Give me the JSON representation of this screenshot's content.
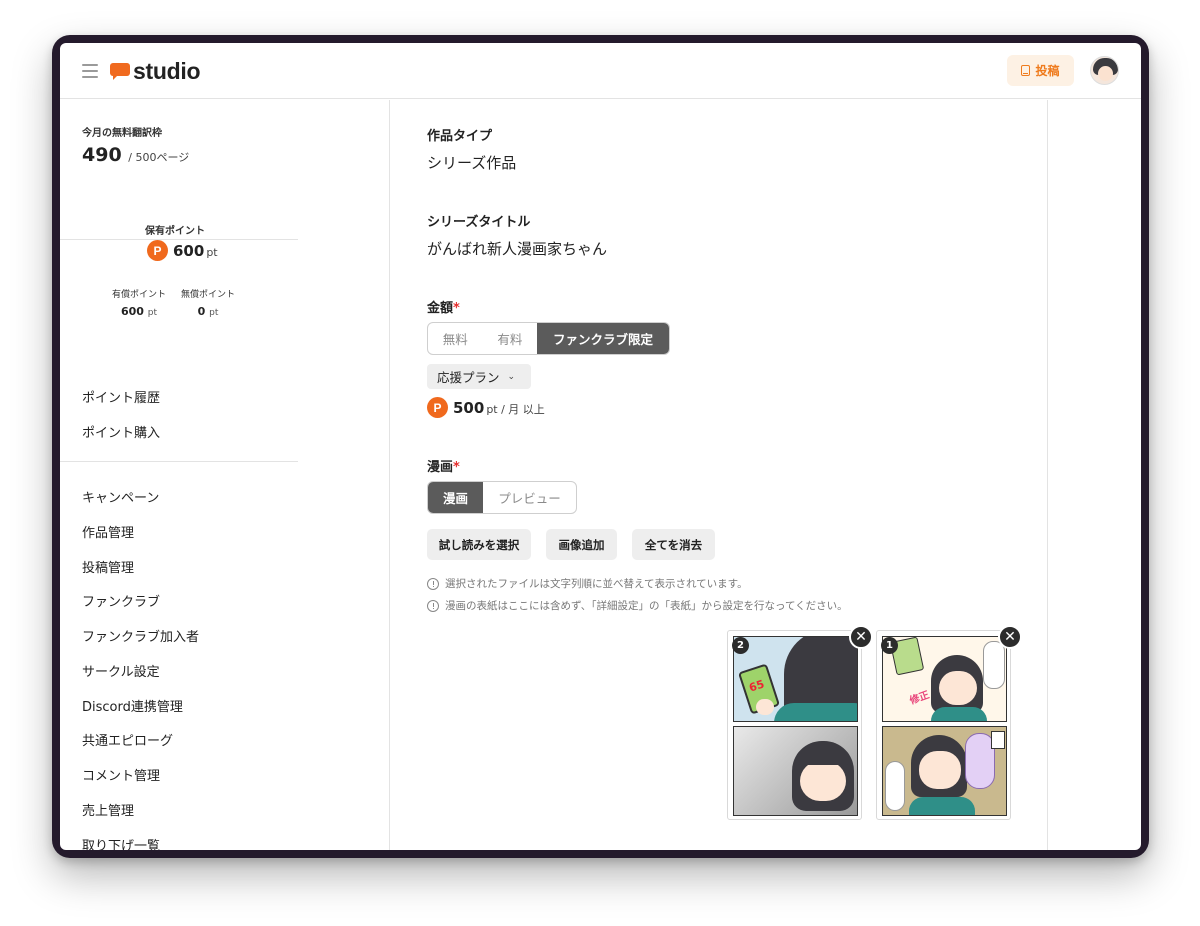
{
  "header": {
    "logo_text": "studio",
    "post_label": "投稿"
  },
  "sidebar": {
    "quota_label": "今月の無料翻訳枠",
    "quota_value": "490",
    "quota_unit": "/ 500ページ",
    "points_label": "保有ポイント",
    "points_value": "600",
    "points_unit": "pt",
    "paid_label": "有償ポイント",
    "paid_value": "600",
    "free_label": "無償ポイント",
    "free_value": "0",
    "unit_pt": "pt",
    "point_links": [
      "ポイント履歴",
      "ポイント購入"
    ],
    "nav_items": [
      "キャンペーン",
      "作品管理",
      "投稿管理",
      "ファンクラブ",
      "ファンクラブ加入者",
      "サークル設定",
      "Discord連携管理",
      "共通エピローグ",
      "コメント管理",
      "売上管理",
      "取り下げ一覧"
    ]
  },
  "main": {
    "work_type_label": "作品タイプ",
    "work_type_value": "シリーズ作品",
    "series_title_label": "シリーズタイトル",
    "series_title_value": "がんばれ新人漫画家ちゃん",
    "price_label": "金額",
    "required_mark": "*",
    "price_options": [
      "無料",
      "有料",
      "ファンクラブ限定"
    ],
    "price_selected": "ファンクラブ限定",
    "plan_select": "応援プラン",
    "plan_price_value": "500",
    "plan_price_unit": "pt / 月 以上",
    "manga_label": "漫画",
    "manga_tabs": [
      "漫画",
      "プレビュー"
    ],
    "manga_tab_selected": "漫画",
    "buttons": [
      "試し読みを選択",
      "画像追加",
      "全てを消去"
    ],
    "notes": [
      "選択されたファイルは文字列順に並べ替えて表示されています。",
      "漫画の表紙はここには含めず、「詳細設定」の「表紙」から設定を行なってください。"
    ],
    "thumbnails": [
      {
        "index": "2",
        "remove": "✕",
        "phone_text": "65"
      },
      {
        "index": "1",
        "remove": "✕",
        "stamp_text": "修正"
      }
    ]
  },
  "colors": {
    "brand": "#f06a1f",
    "active_segment": "#5b5b5b",
    "required": "#e52d2d"
  },
  "icons": [
    "menu-icon",
    "logo-icon",
    "post-icon",
    "avatar",
    "point-coin-icon",
    "chevron-down-icon",
    "info-icon",
    "close-icon"
  ]
}
